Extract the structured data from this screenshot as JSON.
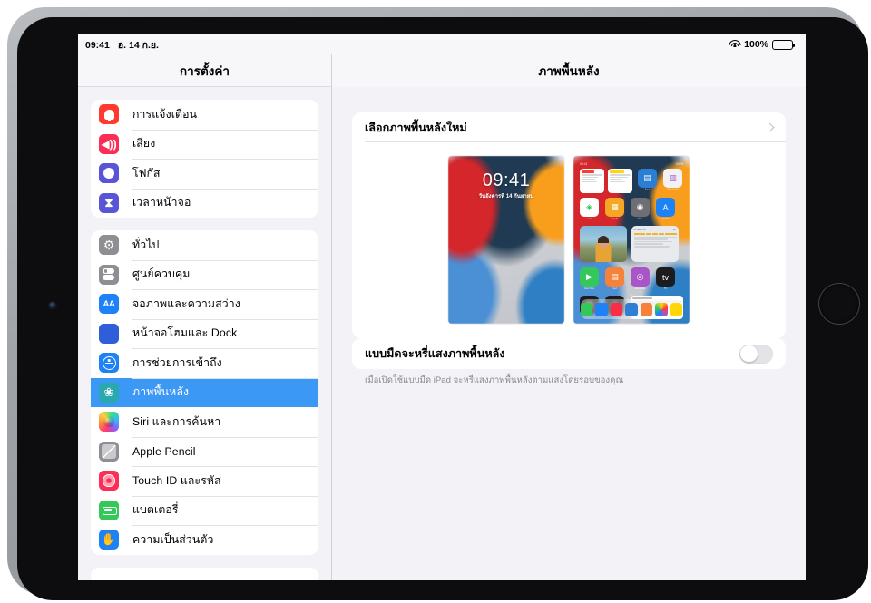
{
  "status_bar": {
    "time": "09:41",
    "date": "อ. 14 ก.ย.",
    "battery_percent": "100%",
    "wifi_icon": "wifi-icon",
    "battery_icon": "battery-icon"
  },
  "sidebar": {
    "title": "การตั้งค่า",
    "groups": [
      {
        "items": [
          {
            "label": "การแจ้งเตือน",
            "icon": "bell-icon",
            "icon_bg": "#ff3b30",
            "selected": false
          },
          {
            "label": "เสียง",
            "icon": "speaker-icon",
            "icon_bg": "#fc2e55",
            "selected": false
          },
          {
            "label": "โฟกัส",
            "icon": "moon-icon",
            "icon_bg": "#5855d6",
            "selected": false
          },
          {
            "label": "เวลาหน้าจอ",
            "icon": "hourglass-icon",
            "icon_bg": "#5855d6",
            "selected": false
          }
        ]
      },
      {
        "items": [
          {
            "label": "ทั่วไป",
            "icon": "gear-icon",
            "icon_bg": "#8e8e93",
            "selected": false
          },
          {
            "label": "ศูนย์ควบคุม",
            "icon": "control-center-icon",
            "icon_bg": "#8e8e93",
            "selected": false
          },
          {
            "label": "จอภาพและความสว่าง",
            "icon": "display-aa-icon",
            "icon_bg": "#1d82f5",
            "selected": false
          },
          {
            "label": "หน้าจอโฮมและ Dock",
            "icon": "home-screen-icon",
            "icon_bg": "#2f5fd8",
            "selected": false
          },
          {
            "label": "การช่วยการเข้าถึง",
            "icon": "accessibility-icon",
            "icon_bg": "#1d82f5",
            "selected": false
          },
          {
            "label": "ภาพพื้นหลัง",
            "icon": "wallpaper-icon",
            "icon_bg": "#2aa8b0",
            "selected": true
          },
          {
            "label": "Siri และการค้นหา",
            "icon": "siri-icon",
            "icon_bg": "#1b1b2e",
            "selected": false
          },
          {
            "label": "Apple Pencil",
            "icon": "pencil-icon",
            "icon_bg": "#8e8e93",
            "selected": false
          },
          {
            "label": "Touch ID และรหัส",
            "icon": "touchid-icon",
            "icon_bg": "#fc2e55",
            "selected": false
          },
          {
            "label": "แบตเตอรี่",
            "icon": "battery-icon",
            "icon_bg": "#34c759",
            "selected": false
          },
          {
            "label": "ความเป็นส่วนตัว",
            "icon": "hand-icon",
            "icon_bg": "#1d82f5",
            "selected": false
          }
        ]
      }
    ]
  },
  "detail": {
    "title": "ภาพพื้นหลัง",
    "choose_wallpaper_label": "เลือกภาพพื้นหลังใหม่",
    "chevron_icon": "chevron-right-icon",
    "previews": {
      "lock_screen": {
        "name": "lock-screen-preview",
        "time": "09:41",
        "date": "วันอังคารที่ 14 กันยายน"
      },
      "home_screen": {
        "name": "home-screen-preview",
        "status_time": "09:41",
        "status_right": "100%",
        "page_dots": "• •",
        "app_labels": [
          "แผนที่",
          "กระเป๋า",
          "กล้อง",
          "App Store",
          "FaceTime",
          "ไฟล์",
          "พ็อดคาสท์",
          "TV",
          "เสียงบันทึก",
          "นาฬิกา"
        ],
        "widget_titles": [
          "ปฏิทิน",
          "บันทึกย่อ"
        ],
        "weather_widget_title": "สภาพอากาศ",
        "list_widget_items": [
          "ข่าวสารวันนี้",
          "เรื่องน่าสนใจ"
        ]
      }
    },
    "dark_appearance": {
      "label": "แบบมืดจะหรี่แสงภาพพื้นหลัง",
      "enabled": false,
      "footnote": "เมื่อเปิดใช้แบบมืด iPad จะหรี่แสงภาพพื้นหลังตามแสงโดยรอบของคุณ"
    }
  },
  "colors": {
    "selection_blue": "#3c98f5",
    "screen_bg": "#f2f2f7",
    "card_bg": "#ffffff",
    "footnote_gray": "#8a8a8e"
  }
}
